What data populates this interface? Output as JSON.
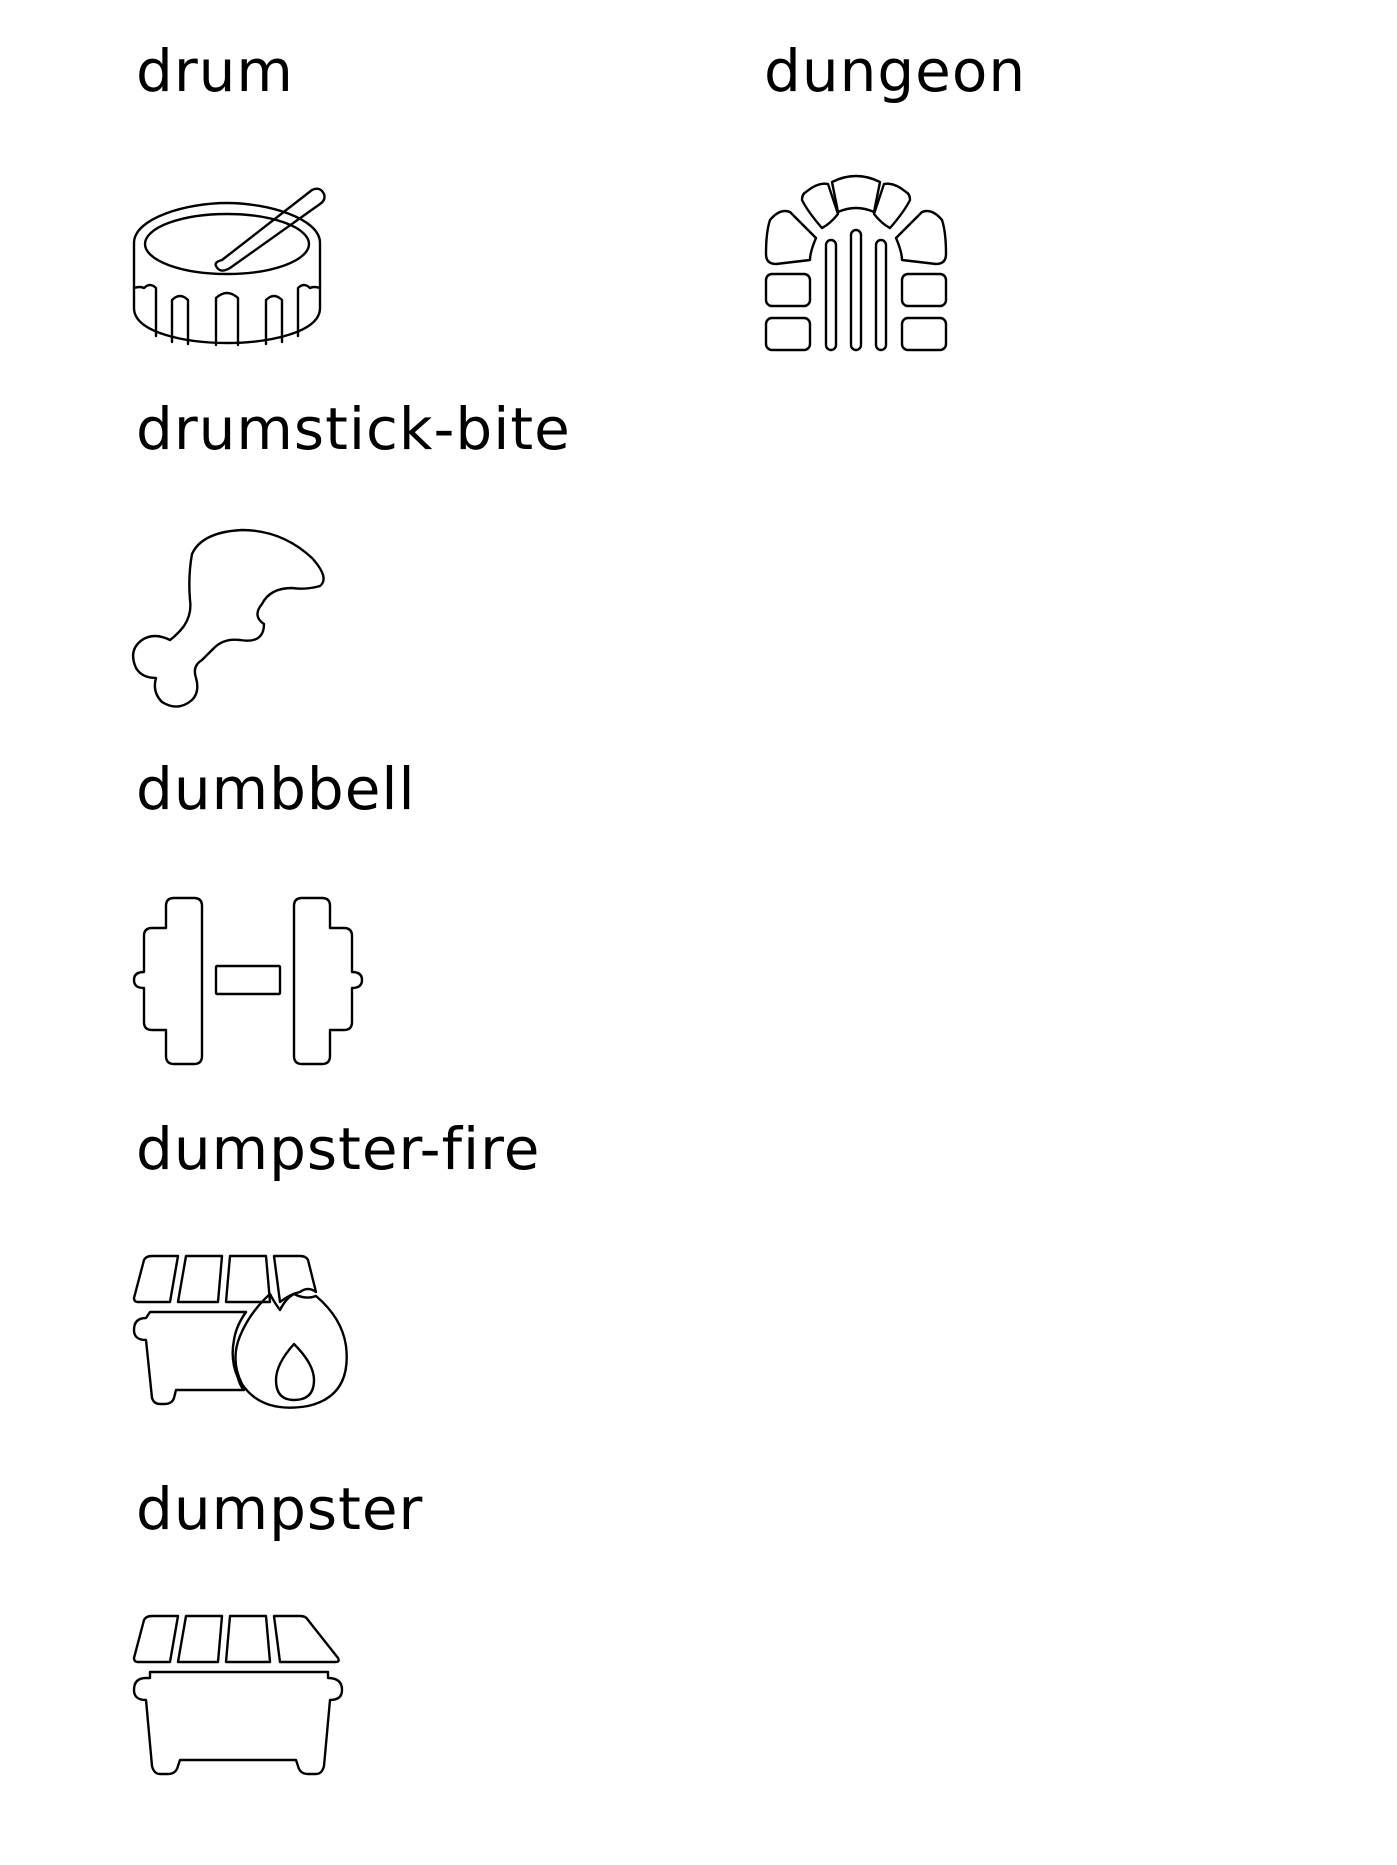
{
  "icons": [
    {
      "key": "drum",
      "label": "drum",
      "icon": "drum-icon"
    },
    {
      "key": "dungeon",
      "label": "dungeon",
      "icon": "dungeon-icon"
    },
    {
      "key": "drumstick_bite",
      "label": "drumstick-bite",
      "icon": "drumstick-bite-icon"
    },
    {
      "key": "dumbbell",
      "label": "dumbbell",
      "icon": "dumbbell-icon"
    },
    {
      "key": "dumpster_fire",
      "label": "dumpster-fire",
      "icon": "dumpster-fire-icon"
    },
    {
      "key": "dumpster",
      "label": "dumpster",
      "icon": "dumpster-icon"
    }
  ],
  "colors": {
    "background": "#ffffff",
    "ink": "#000000"
  }
}
